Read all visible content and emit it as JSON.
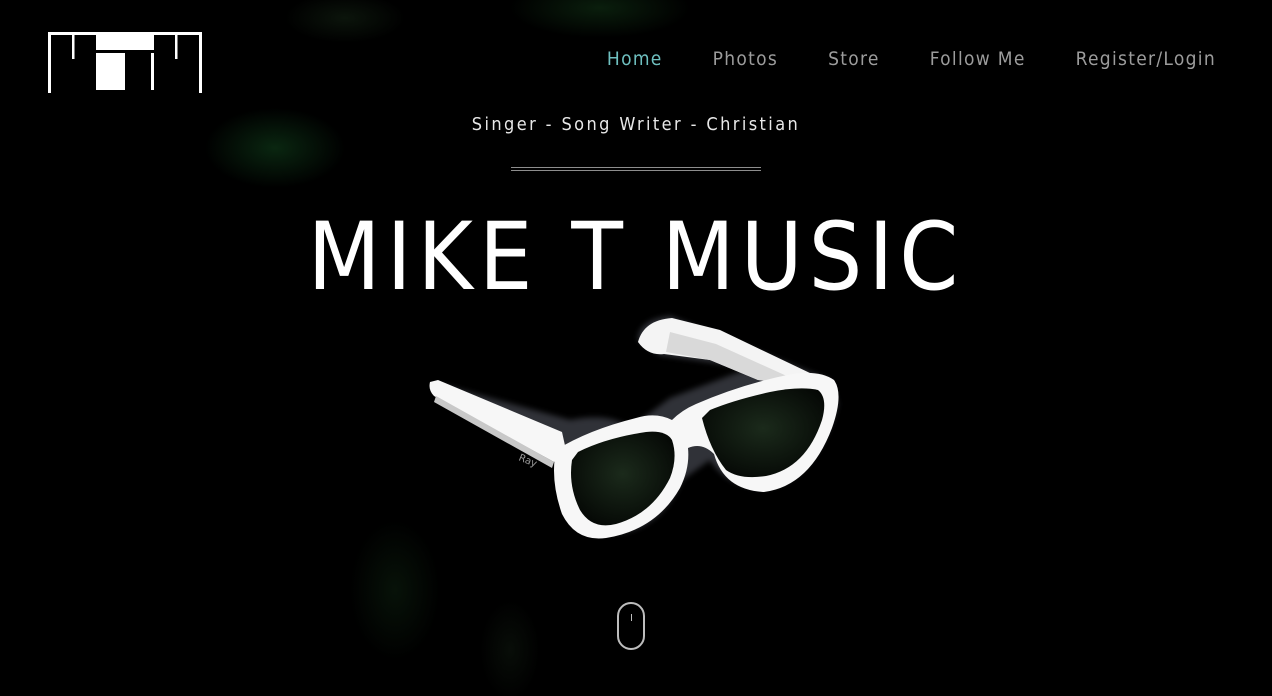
{
  "brand": {
    "logo_icon": "mtm-logo-icon",
    "logo_color": "#ffffff"
  },
  "nav": {
    "items": [
      {
        "label": "Home",
        "active": true
      },
      {
        "label": "Photos",
        "active": false
      },
      {
        "label": "Store",
        "active": false
      },
      {
        "label": "Follow Me",
        "active": false
      },
      {
        "label": "Register/Login",
        "active": false
      }
    ],
    "active_color": "#6fc0c0",
    "inactive_color": "#9c9c9c"
  },
  "hero": {
    "tagline": "Singer - Song Writer - Christian",
    "title": "MIKE T MUSIC",
    "image_icon": "white-sunglasses-icon",
    "scroll_icon": "scroll-mouse-icon"
  },
  "colors": {
    "background": "#000000",
    "text": "#ffffff"
  }
}
